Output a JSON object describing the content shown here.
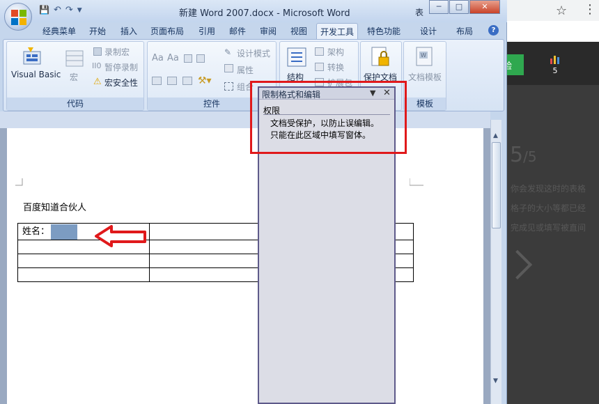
{
  "window": {
    "title": "新建 Word 2007.docx - Microsoft Word",
    "title_extra": "表",
    "controls": {
      "minimize": "─",
      "maximize": "□",
      "close": "✕"
    }
  },
  "qat": {
    "save": "💾",
    "undo": "↶",
    "redo": "↷"
  },
  "tabs": [
    {
      "label": "经典菜单"
    },
    {
      "label": "开始"
    },
    {
      "label": "插入"
    },
    {
      "label": "页面布局"
    },
    {
      "label": "引用"
    },
    {
      "label": "邮件"
    },
    {
      "label": "审阅"
    },
    {
      "label": "视图"
    },
    {
      "label": "开发工具"
    },
    {
      "label": "特色功能"
    },
    {
      "label": "设计"
    },
    {
      "label": "布局"
    }
  ],
  "ribbon": {
    "code": {
      "label": "代码",
      "visual_basic": "Visual Basic",
      "macro": "宏",
      "record_macro": "录制宏",
      "pause_recording": "暂停录制",
      "macro_security": "宏安全性"
    },
    "controls": {
      "label": "控件",
      "design_mode": "设计模式",
      "properties": "属性",
      "group": "组合"
    },
    "xml": {
      "structure": "结构",
      "schema": "架构",
      "transform": "转换",
      "expansion": "扩展包"
    },
    "protect": {
      "protect_document": "保护文档"
    },
    "templates": {
      "label": "模板",
      "document_template": "文档模板"
    }
  },
  "document": {
    "heading": "百度知道合伙人",
    "table": {
      "name_label": "姓名："
    }
  },
  "task_pane": {
    "title": "限制格式和编辑",
    "menu_icon": "▼",
    "close_icon": "✕",
    "section": "权限",
    "lines": [
      "文档受保护，以防止误编辑。",
      "只能在此区域中填写窗体。"
    ]
  },
  "browser_bg": {
    "star": "☆",
    "menu": "⋮",
    "green_label": "验",
    "chart_count": "5",
    "page_num": "5",
    "page_total": "/5",
    "lines": [
      "你会发现这时的表格",
      "格子的大小等都已经",
      "完成见或填写被直间"
    ]
  },
  "colors": {
    "highlight_red": "#e0191b",
    "form_field": "#7c9cc2",
    "pane_border": "#5e5a8a"
  },
  "icons": {
    "save": "save-icon",
    "undo": "undo-icon",
    "redo": "redo-icon",
    "help": "help-icon"
  }
}
